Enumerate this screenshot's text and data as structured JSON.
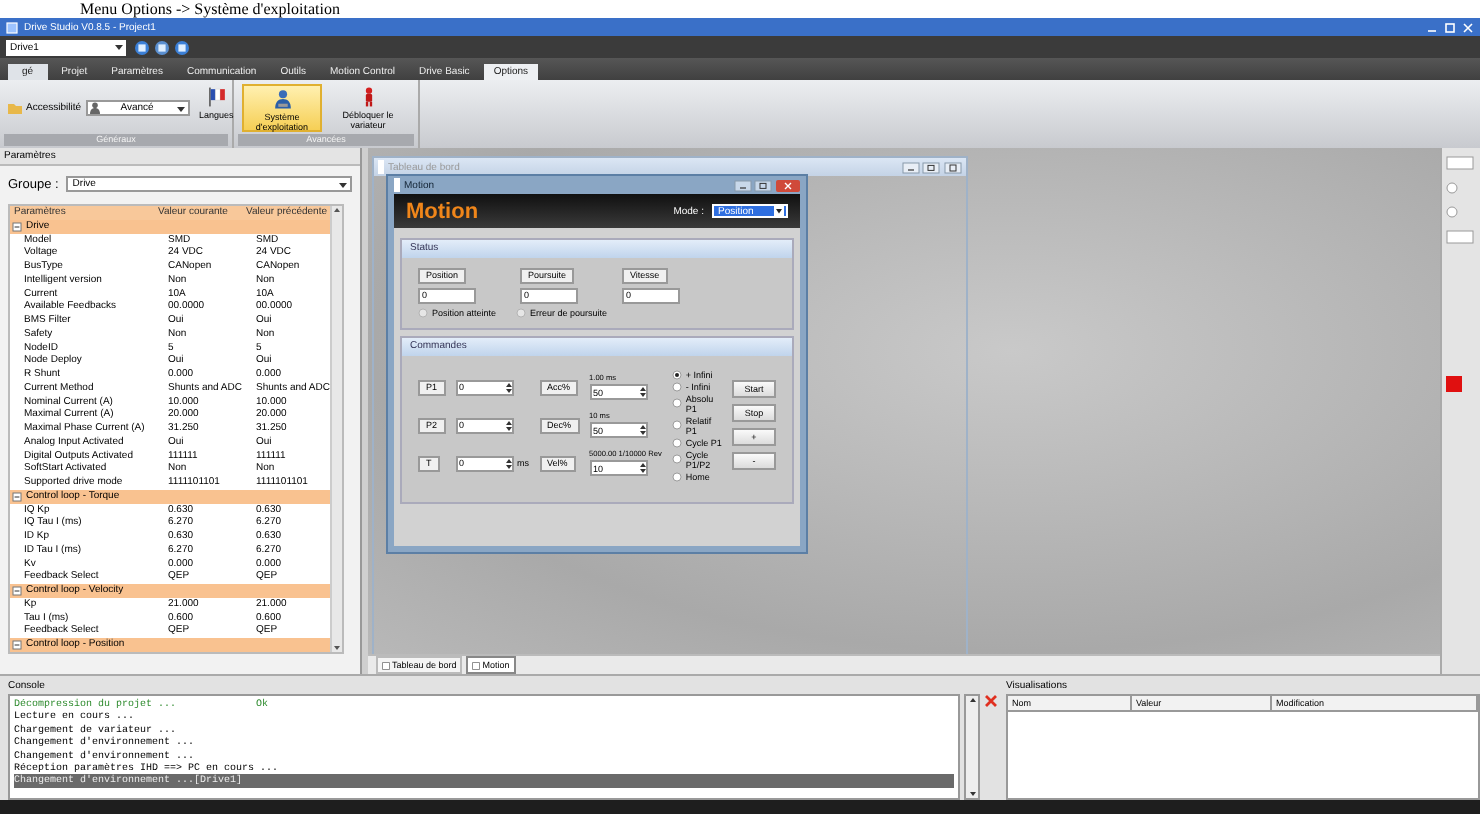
{
  "caption": "Menu Options -> Système d'exploitation",
  "window": {
    "title": "Drive Studio V0.8.5 - Project1"
  },
  "drive_selector": {
    "value": "Drive1"
  },
  "app_button": {
    "label": "gé"
  },
  "tabs": [
    {
      "label": "Projet",
      "selected": false
    },
    {
      "label": "Paramètres",
      "selected": false
    },
    {
      "label": "Communication",
      "selected": false
    },
    {
      "label": "Outils",
      "selected": false
    },
    {
      "label": "Motion Control",
      "selected": false
    },
    {
      "label": "Drive Basic",
      "selected": false
    },
    {
      "label": "Options",
      "selected": true
    }
  ],
  "ribbon": {
    "groups": [
      {
        "label": "Généraux",
        "accessibility": {
          "label": "Accessibilité",
          "value": "Avancé"
        },
        "buttons": [
          {
            "label": "Langues",
            "kind": "flag",
            "selected": false
          }
        ]
      },
      {
        "label": "Avancées",
        "buttons": [
          {
            "label": "Système d'exploitation",
            "kind": "user",
            "selected": true
          },
          {
            "label": "Débloquer le variateur",
            "kind": "unlock",
            "selected": false
          }
        ]
      }
    ]
  },
  "parameters": {
    "title": "Paramètres",
    "group_label": "Groupe :",
    "group_value": "Drive",
    "columns": [
      "Paramètres",
      "Valeur courante",
      "Valeur précédente"
    ],
    "sections": [
      {
        "name": "Drive",
        "expanded": true,
        "rows": [
          [
            "Model",
            "SMD",
            "SMD"
          ],
          [
            "Voltage",
            "24 VDC",
            "24 VDC"
          ],
          [
            "BusType",
            "CANopen",
            "CANopen"
          ],
          [
            "Intelligent version",
            "Non",
            "Non"
          ],
          [
            "Current",
            "10A",
            "10A"
          ],
          [
            "Available Feedbacks",
            "00.0000",
            "00.0000"
          ],
          [
            "BMS Filter",
            "Oui",
            "Oui"
          ],
          [
            "Safety",
            "Non",
            "Non"
          ],
          [
            "NodeID",
            "5",
            "5"
          ],
          [
            "Node Deploy",
            "Oui",
            "Oui"
          ],
          [
            "R Shunt",
            "0.000",
            "0.000"
          ],
          [
            "Current Method",
            "Shunts and ADC",
            "Shunts and ADC"
          ],
          [
            "Nominal Current (A)",
            "10.000",
            "10.000"
          ],
          [
            "Maximal Current (A)",
            "20.000",
            "20.000"
          ],
          [
            "Maximal Phase Current (A)",
            "31.250",
            "31.250"
          ],
          [
            "Analog Input Activated",
            "Oui",
            "Oui"
          ],
          [
            "Digital Outputs Activated",
            "111111",
            "111111"
          ],
          [
            "SoftStart Activated",
            "Non",
            "Non"
          ],
          [
            "Supported drive mode",
            "1111101101",
            "1111101101"
          ]
        ]
      },
      {
        "name": "Control loop - Torque",
        "expanded": true,
        "rows": [
          [
            "IQ Kp",
            "0.630",
            "0.630"
          ],
          [
            "IQ Tau I (ms)",
            "6.270",
            "6.270"
          ],
          [
            "ID Kp",
            "0.630",
            "0.630"
          ],
          [
            "ID Tau I (ms)",
            "6.270",
            "6.270"
          ],
          [
            "Kv",
            "0.000",
            "0.000"
          ],
          [
            "Feedback Select",
            "QEP",
            "QEP"
          ]
        ]
      },
      {
        "name": "Control loop - Velocity",
        "expanded": true,
        "rows": [
          [
            "Kp",
            "21.000",
            "21.000"
          ],
          [
            "Tau I (ms)",
            "0.600",
            "0.600"
          ],
          [
            "Feedback Select",
            "QEP",
            "QEP"
          ]
        ]
      },
      {
        "name": "Control loop - Position",
        "expanded": true
      }
    ]
  },
  "dashboard": {
    "title": "Tableau de bord"
  },
  "motion": {
    "window_title": "Motion",
    "heading": "Motion",
    "mode_label": "Mode :",
    "mode_value": "Position",
    "status": {
      "title": "Status",
      "fields": [
        {
          "label": "Position",
          "value": "0"
        },
        {
          "label": "Poursuite",
          "value": "0"
        },
        {
          "label": "Vitesse",
          "value": "0"
        }
      ],
      "indicators": [
        {
          "label": "Position atteinte",
          "on": false
        },
        {
          "label": "Erreur de poursuite",
          "on": false
        }
      ]
    },
    "commands": {
      "title": "Commandes",
      "rows": [
        {
          "label": "P1",
          "value": "0",
          "unit": null,
          "param_label": "Acc%",
          "param_value": "50",
          "note": "1.00 ms"
        },
        {
          "label": "P2",
          "value": "0",
          "unit": null,
          "param_label": "Dec%",
          "param_value": "50",
          "note": "10 ms"
        },
        {
          "label": "T",
          "value": "0",
          "unit": "ms",
          "param_label": "Vel%",
          "param_value": "10",
          "note": "5000.00 1/10000 Rev"
        }
      ],
      "options": [
        {
          "label": "+ Infini",
          "selected": true
        },
        {
          "label": "- Infini",
          "selected": false
        },
        {
          "label": "Absolu P1",
          "selected": false
        },
        {
          "label": "Relatif P1",
          "selected": false
        },
        {
          "label": "Cycle P1",
          "selected": false
        },
        {
          "label": "Cycle P1/P2",
          "selected": false
        },
        {
          "label": "Home",
          "selected": false
        }
      ],
      "buttons": [
        "Start",
        "Stop",
        "+",
        "-"
      ]
    }
  },
  "document_tabs": [
    {
      "label": "Tableau de bord",
      "selected": false
    },
    {
      "label": "Motion",
      "selected": true
    }
  ],
  "console": {
    "title": "Console",
    "lines": [
      {
        "text": "Décompression du projet ...",
        "result": "Ok",
        "kind": "success",
        "selected": false
      },
      {
        "text": "Lecture en cours ...",
        "kind": "info",
        "selected": false
      },
      {
        "text": "Chargement de variateur ...",
        "kind": "info",
        "selected": false
      },
      {
        "text": "Changement d'environnement ...",
        "kind": "info",
        "selected": false
      },
      {
        "text": "Changement d'environnement ...",
        "kind": "info",
        "selected": false
      },
      {
        "text": "Réception paramètres IHD ==> PC en cours ...",
        "kind": "info",
        "selected": false
      },
      {
        "text": "Changement d'environnement ...[Drive1]",
        "kind": "info",
        "selected": true
      }
    ]
  },
  "visualisations": {
    "title": "Visualisations",
    "columns": [
      "Nom",
      "Valeur",
      "Modification"
    ]
  }
}
